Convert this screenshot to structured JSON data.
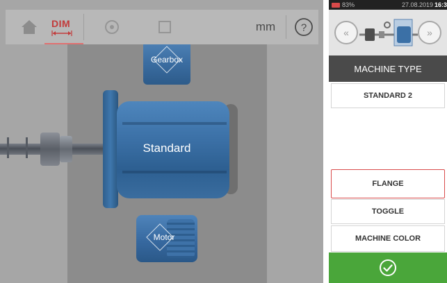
{
  "toolbar": {
    "home_icon": "home-icon",
    "dim_label": "DIM",
    "units": "mm",
    "help_label": "?"
  },
  "canvas": {
    "gearbox_label": "Gearbox",
    "standard_label": "Standard",
    "motor_label": "Motor"
  },
  "status_bar": {
    "battery_pct": "83%",
    "date": "27.08.2019",
    "time": "16:3"
  },
  "panel": {
    "header": "MACHINE TYPE",
    "selected_type": "STANDARD 2",
    "flange_label": "FLANGE",
    "toggle_label": "TOGGLE",
    "color_label": "MACHINE COLOR",
    "confirm_icon": "checkmark-circle-icon"
  },
  "colors": {
    "accent_red": "#d94a4a",
    "confirm_green": "#4aa63a",
    "machine_blue": "#3b70a6",
    "header_dark": "#4a4a4a"
  }
}
